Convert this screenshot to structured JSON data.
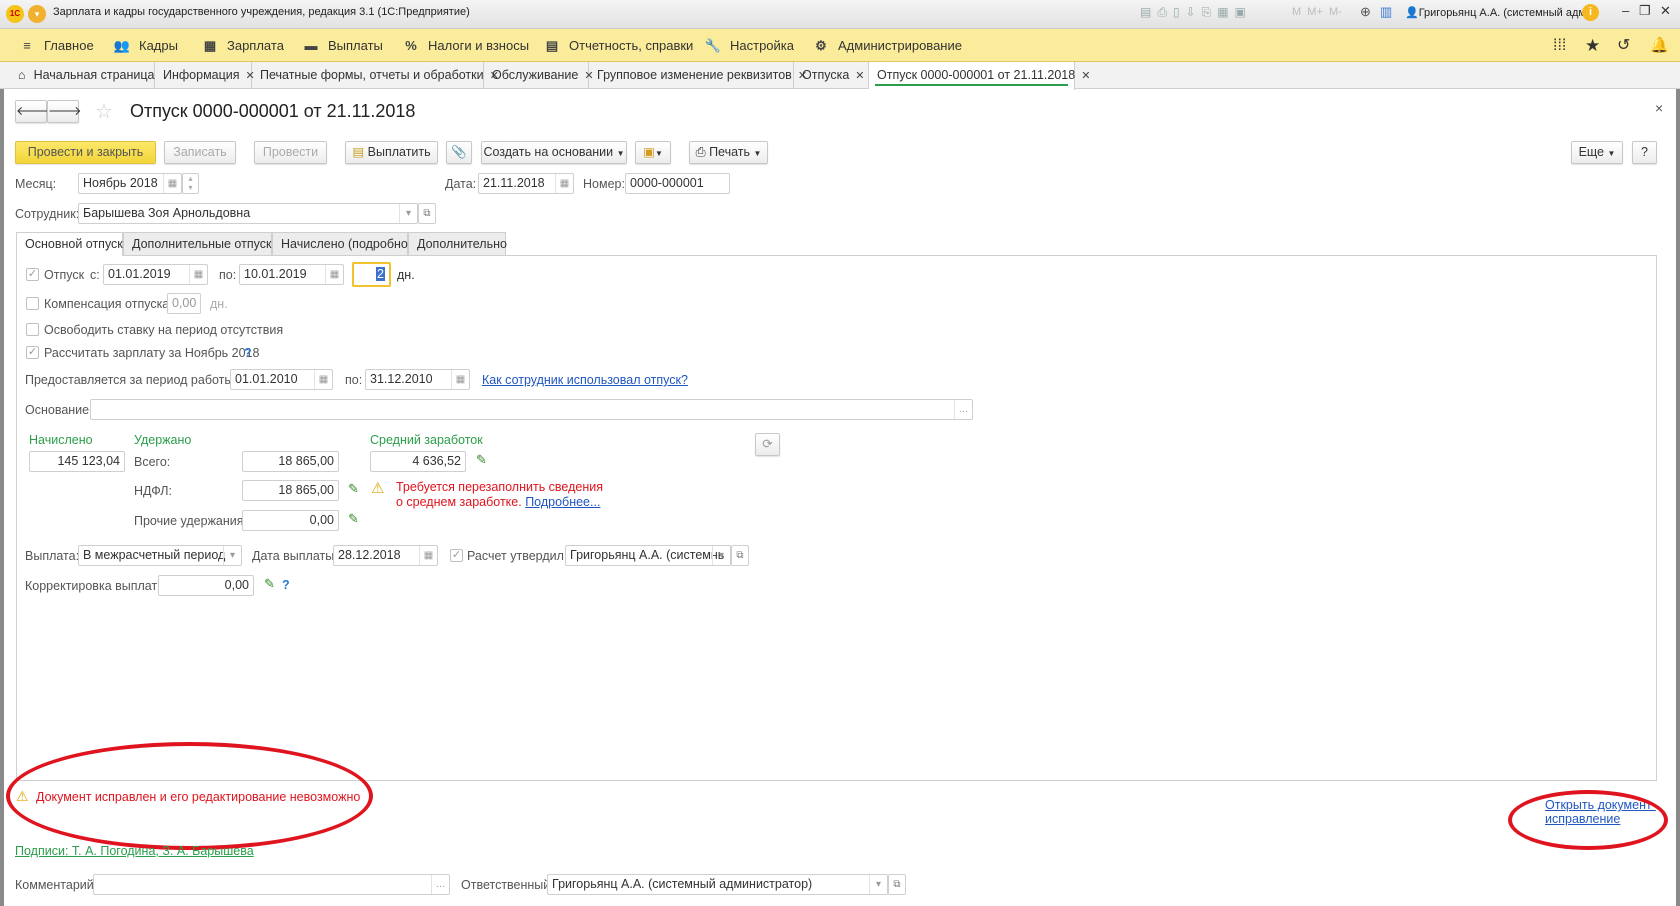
{
  "window": {
    "title": "Зарплата и кадры государственного учреждения, редакция 3.1  (1С:Предприятие)",
    "user": "Григорьянц А.А. (системный адм...",
    "calc_buttons": [
      "M",
      "M+",
      "M-"
    ]
  },
  "menu": {
    "items": [
      {
        "label": "Главное",
        "icon": "hamburger-icon"
      },
      {
        "label": "Кадры",
        "icon": "people-icon"
      },
      {
        "label": "Зарплата",
        "icon": "calculator-icon"
      },
      {
        "label": "Выплаты",
        "icon": "wallet-icon"
      },
      {
        "label": "Налоги и взносы",
        "icon": "percent-icon"
      },
      {
        "label": "Отчетность, справки",
        "icon": "report-icon"
      },
      {
        "label": "Настройка",
        "icon": "wrench-icon"
      },
      {
        "label": "Администрирование",
        "icon": "gear-icon"
      }
    ]
  },
  "tabs": [
    {
      "label": "Начальная страница"
    },
    {
      "label": "Информация"
    },
    {
      "label": "Печатные формы, отчеты и обработки"
    },
    {
      "label": "Обслуживание"
    },
    {
      "label": "Групповое изменение реквизитов"
    },
    {
      "label": "Отпуска"
    },
    {
      "label": "Отпуск 0000-000001 от 21.11.2018",
      "active": true
    }
  ],
  "document": {
    "title": "Отпуск 0000-000001 от 21.11.2018"
  },
  "toolbar": {
    "post_close": "Провести и закрыть",
    "save": "Записать",
    "post": "Провести",
    "pay": "Выплатить",
    "create_based": "Создать на основании",
    "print": "Печать",
    "more": "Еще",
    "help": "?"
  },
  "header": {
    "month_label": "Месяц:",
    "month": "Ноябрь 2018",
    "date_label": "Дата:",
    "date": "21.11.2018",
    "number_label": "Номер:",
    "number": "0000-000001",
    "employee_label": "Сотрудник:",
    "employee": "Барышева Зоя Арнольдовна"
  },
  "inner_tabs": [
    "Основной отпуск",
    "Дополнительные отпуска",
    "Начислено (подробно)",
    "Дополнительно"
  ],
  "main": {
    "vacation_label": "Отпуск",
    "from_label": "с:",
    "from": "01.01.2019",
    "to_label": "по:",
    "to": "10.01.2019",
    "days": "2",
    "days_unit": "дн.",
    "vacation_checked": true,
    "compensation_label": "Компенсация отпуска",
    "compensation": "0,00",
    "compensation_unit": "дн.",
    "release_label": "Освободить ставку на период отсутствия",
    "calc_salary_label": "Рассчитать зарплату за Ноябрь 2018",
    "calc_salary_checked": true,
    "help": "?",
    "period_label": "Предоставляется за период работы с:",
    "period_from": "01.01.2010",
    "period_to_label": "по:",
    "period_to": "31.12.2010",
    "usage_link": "Как сотрудник использовал отпуск?",
    "basis_label": "Основание:",
    "basis": "",
    "accrued_label": "Начислено",
    "accrued": "145 123,04",
    "withheld_label": "Удержано",
    "total_label": "Всего:",
    "total": "18 865,00",
    "ndfl_label": "НДФЛ:",
    "ndfl": "18 865,00",
    "other_label": "Прочие удержания:",
    "other": "0,00",
    "avg_label": "Средний заработок",
    "avg": "4 636,52",
    "warning_line1": "Требуется перезаполнить сведения",
    "warning_line2": "о среднем заработке.",
    "warning_link": "Подробнее...",
    "payout_label": "Выплата:",
    "payout": "В межрасчетный период",
    "pay_date_label": "Дата выплаты:",
    "pay_date": "28.12.2018",
    "approved_label": "Расчет утвердил",
    "approved_checked": true,
    "approver": "Григорьянц А.А. (системнь",
    "correction_label": "Корректировка выплаты:",
    "correction": "0,00"
  },
  "footer": {
    "locked_warning": "Документ исправлен и его редактирование невозможно",
    "open_correction_line1": "Открыть документ-",
    "open_correction_line2": "исправление",
    "signatures": "Подписи: Т. А. Погодина, З. А. Барышева",
    "comment_label": "Комментарий:",
    "comment": "",
    "responsible_label": "Ответственный:",
    "responsible": "Григорьянц А.А. (системный администратор)"
  },
  "colors": {
    "menu_bg": "#fbec9c",
    "accent_green": "#2a9e4a",
    "warning_red": "#e0141e",
    "link_blue": "#2056c0",
    "primary_button": "#f3d53a"
  }
}
